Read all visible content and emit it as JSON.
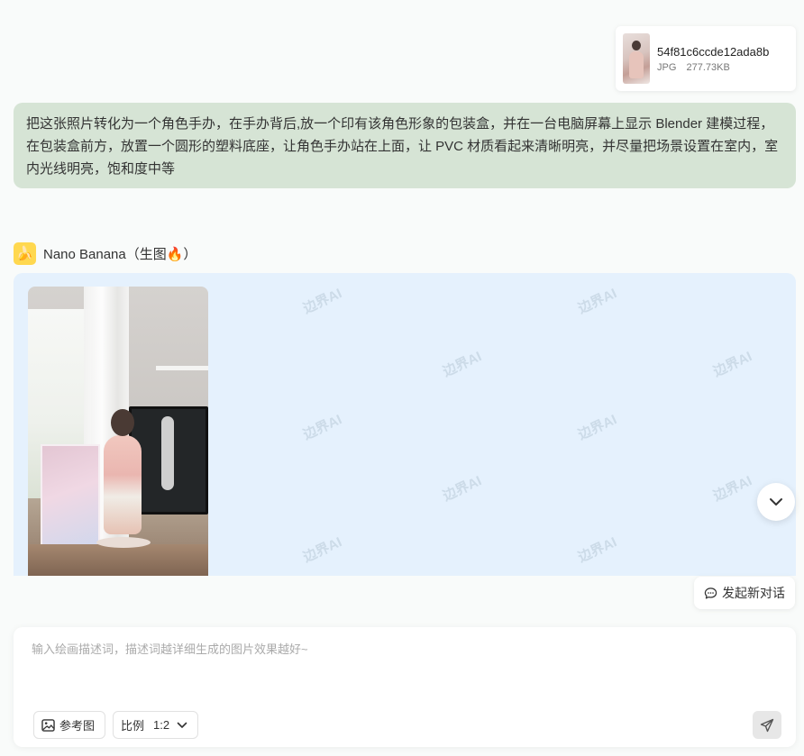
{
  "attachment": {
    "filename": "54f81c6ccde12ada8b",
    "filetype": "JPG",
    "filesize": "277.73KB"
  },
  "user_message": {
    "text": "把这张照片转化为一个角色手办，在手办背后,放一个印有该角色形象的包装盒，并在一台电脑屏幕上显示 Blender 建模过程，在包装盒前方，放置一个圆形的塑料底座，让角色手办站在上面，让 PVC 材质看起来清晰明亮，并尽量把场景设置在室内，室内光线明亮，饱和度中等"
  },
  "bot": {
    "avatar_icon": "banana-icon",
    "name": "Nano Banana（生图🔥）"
  },
  "response": {
    "watermark": "边界AI"
  },
  "new_chat": {
    "label": "发起新对话"
  },
  "composer": {
    "placeholder": "输入绘画描述词，描述词越详细生成的图片效果越好~",
    "reference_label": "参考图",
    "ratio_label": "比例",
    "ratio_value": "1:2"
  },
  "colors": {
    "user_bubble": "#d6e4d5",
    "response_bg": "#e5f1fd",
    "page_bg": "#f9fbfa"
  }
}
